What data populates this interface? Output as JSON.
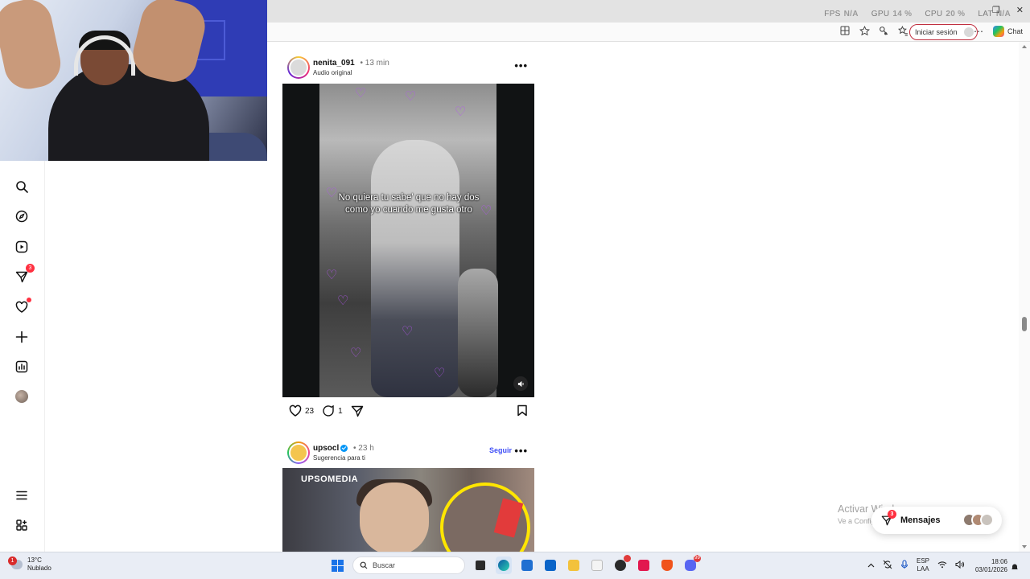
{
  "overlay": {
    "stats": [
      {
        "key": "FPS",
        "value": "N/A"
      },
      {
        "key": "GPU",
        "value": "14 %"
      },
      {
        "key": "CPU",
        "value": "20 %"
      },
      {
        "key": "LAT",
        "value": "N/A"
      }
    ]
  },
  "browser": {
    "signin_label": "Iniciar sesión",
    "copilot_label": "Chat"
  },
  "sidebar": {
    "messages_badge": "3"
  },
  "posts": [
    {
      "username": "nenita_091",
      "time": "13 min",
      "subtitle": "Audio original",
      "caption": "No quiera tu sabe' que no hay dos como  yo cuando me gusta otro",
      "likes": "23",
      "comments": "1"
    },
    {
      "username": "upsocl",
      "time": "23 h",
      "subtitle": "Sugerencia para ti",
      "follow_label": "Seguir",
      "media_brand": "UPSOMEDIA"
    }
  ],
  "watermark": {
    "title": "Activar Windows",
    "subtitle": "Ve a Configuración para activar Windows."
  },
  "messages": {
    "label": "Mensajes",
    "badge": "3"
  },
  "taskbar": {
    "weather_badge": "1",
    "temperature": "13°C",
    "condition": "Nublado",
    "search_placeholder": "Buscar",
    "discord_badge": "99",
    "lang_top": "ESP",
    "lang_bottom": "LAA",
    "time": "18:06",
    "date": "03/01/2026"
  },
  "colors": {
    "accent_blue": "#4150f7",
    "notification_red": "#ff3040",
    "caption_hearts": "#b455f0",
    "ring_yellow": "#ffe600"
  }
}
